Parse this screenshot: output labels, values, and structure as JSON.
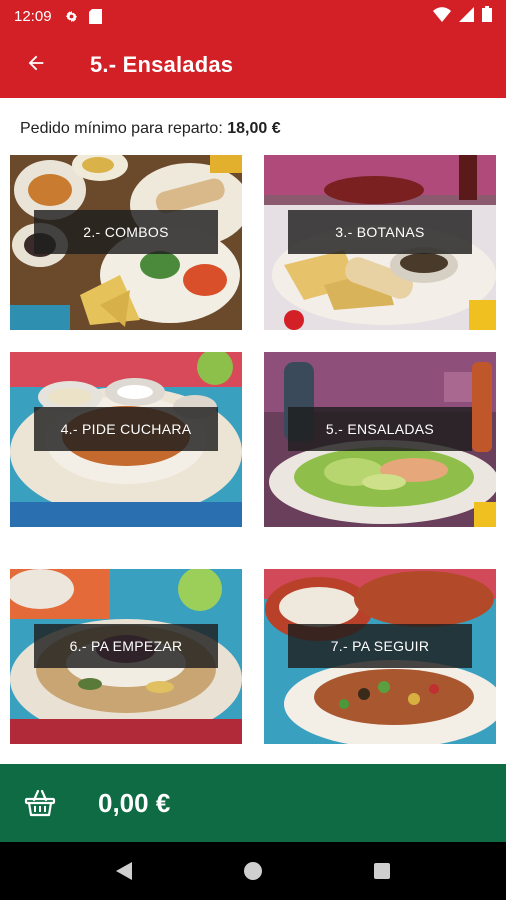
{
  "status_bar": {
    "time": "12:09",
    "icons": [
      "gear-icon",
      "sd-card-icon",
      "wifi-icon",
      "signal-icon",
      "battery-icon"
    ]
  },
  "header": {
    "title": "5.- Ensaladas",
    "back_icon": "arrow-left-icon"
  },
  "min_order": {
    "label": "Pedido mínimo para reparto:",
    "value": "18,00 €"
  },
  "categories": [
    {
      "label": "2.- COMBOS"
    },
    {
      "label": "3.- BOTANAS"
    },
    {
      "label": "4.- PIDE CUCHARA"
    },
    {
      "label": "5.- ENSALADAS"
    },
    {
      "label": "6.- PA EMPEZAR"
    },
    {
      "label": "7.- PA SEGUIR"
    }
  ],
  "cart": {
    "total": "0,00 €",
    "icon": "basket-icon"
  },
  "nav": [
    "back-triangle-icon",
    "home-circle-icon",
    "recents-square-icon"
  ],
  "colors": {
    "primary": "#d32026",
    "cart_bar": "#0e6b43",
    "label_bg": "#1e1e1e"
  }
}
